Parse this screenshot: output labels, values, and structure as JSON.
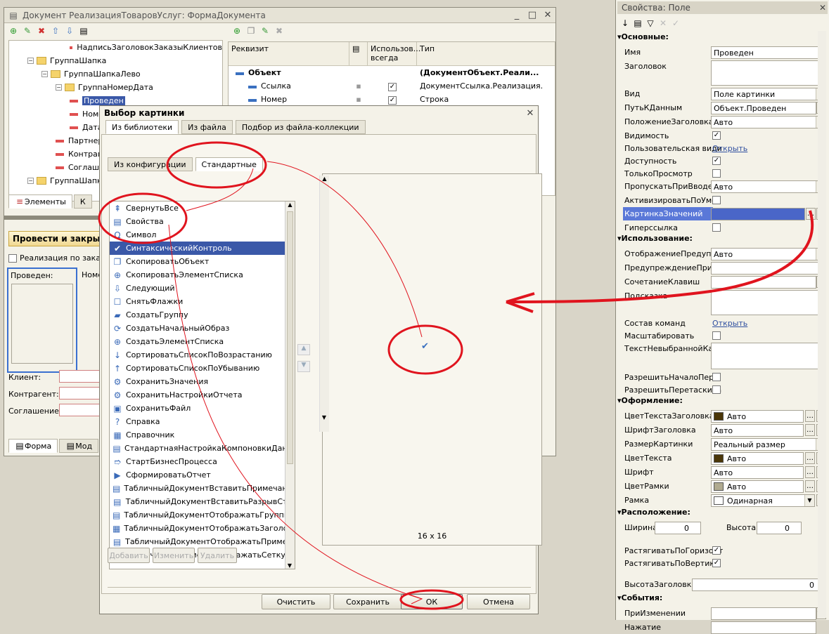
{
  "main": {
    "title": "Документ РеализацияТоваровУслуг: ФормаДокумента",
    "tree": [
      {
        "label": "НадписьЗаголовокЗаказыКлиентов",
        "indent": 4,
        "kind": "item"
      },
      {
        "label": "ГруппаШапка",
        "indent": 1,
        "kind": "group"
      },
      {
        "label": "ГруппаШапкаЛево",
        "indent": 2,
        "kind": "group"
      },
      {
        "label": "ГруппаНомерДата",
        "indent": 3,
        "kind": "group"
      },
      {
        "label": "Проведен",
        "indent": 4,
        "kind": "sel"
      },
      {
        "label": "Номер",
        "indent": 4,
        "kind": "item"
      },
      {
        "label": "Дата",
        "indent": 4,
        "kind": "item"
      },
      {
        "label": "Партнер",
        "indent": 3,
        "kind": "item"
      },
      {
        "label": "Контрагент",
        "indent": 3,
        "kind": "item"
      },
      {
        "label": "Соглашение",
        "indent": 3,
        "kind": "item"
      },
      {
        "label": "ГруппаШапка",
        "indent": 1,
        "kind": "group"
      }
    ],
    "tab_elements": "Элементы",
    "tab_k": "К",
    "grid_cols": {
      "rekvizit": "Реквизит",
      "use": "Использов... всегда",
      "type": "Тип"
    },
    "grid_rows": [
      {
        "name": "Объект",
        "type": "(ДокументОбъект.Реали...",
        "bold": true
      },
      {
        "name": "Ссылка",
        "type": "ДокументСсылка.Реализация..."
      },
      {
        "name": "Номер",
        "type": "Строка"
      }
    ],
    "form_btn": "Провести и закрыть",
    "form_check": "Реализация по заказу",
    "form_posted": "Проведен:",
    "form_nomer": "Номе",
    "form_client": "Клиент:",
    "form_contr": "Контрагент:",
    "form_sogl": "Соглашение:",
    "tab_forma": "Форма",
    "tab_mod": "Мод"
  },
  "dialog": {
    "title": "Выбор картинки",
    "tabs": [
      "Из библиотеки",
      "Из файла",
      "Подбор из файла-коллекции"
    ],
    "subtabs": [
      "Из конфигурации",
      "Стандартные"
    ],
    "items": [
      {
        "label": "СвернутьВсе",
        "icon": "⇞"
      },
      {
        "label": "Свойства",
        "icon": "▤"
      },
      {
        "label": "Символ",
        "icon": "Ω"
      },
      {
        "label": "СинтаксическийКонтроль",
        "icon": "✔",
        "sel": true
      },
      {
        "label": "СкопироватьОбъект",
        "icon": "❐"
      },
      {
        "label": "СкопироватьЭлементСписка",
        "icon": "⊕"
      },
      {
        "label": "Следующий",
        "icon": "⇩"
      },
      {
        "label": "СнятьФлажки",
        "icon": "☐"
      },
      {
        "label": "СоздатьГруппу",
        "icon": "▰"
      },
      {
        "label": "СоздатьНачальныйОбраз",
        "icon": "⟳"
      },
      {
        "label": "СоздатьЭлементСписка",
        "icon": "⊕"
      },
      {
        "label": "СортироватьСписокПоВозрастанию",
        "icon": "↓"
      },
      {
        "label": "СортироватьСписокПоУбыванию",
        "icon": "↑"
      },
      {
        "label": "СохранитьЗначения",
        "icon": "⚙"
      },
      {
        "label": "СохранитьНастройкиОтчета",
        "icon": "⚙"
      },
      {
        "label": "СохранитьФайл",
        "icon": "▣"
      },
      {
        "label": "Справка",
        "icon": "?"
      },
      {
        "label": "Справочник",
        "icon": "▦"
      },
      {
        "label": "СтандартнаяНастройкаКомпоновкиДан...",
        "icon": "▤"
      },
      {
        "label": "СтартБизнесПроцесса",
        "icon": "➱"
      },
      {
        "label": "СформироватьОтчет",
        "icon": "▶"
      },
      {
        "label": "ТабличныйДокументВставитьПримечан...",
        "icon": "▤"
      },
      {
        "label": "ТабличныйДокументВставитьРазрывСт...",
        "icon": "▤"
      },
      {
        "label": "ТабличныйДокументОтображатьГруппи...",
        "icon": "▤"
      },
      {
        "label": "ТабличныйДокументОтображатьЗаголо...",
        "icon": "▦"
      },
      {
        "label": "ТабличныйДокументОтображатьПриме...",
        "icon": "▤"
      },
      {
        "label": "ТабличныйДокументОтображатьСетку",
        "icon": "▦"
      }
    ],
    "size": "16 x 16",
    "add": "Добавить",
    "change": "Изменить",
    "delete": "Удалить",
    "clear": "Очистить",
    "save": "Сохранить",
    "ok": "ОК",
    "cancel": "Отмена"
  },
  "props": {
    "title": "Свойства: Поле",
    "s_main": "Основные:",
    "s_use": "Использование:",
    "s_design": "Оформление:",
    "s_layout": "Расположение:",
    "s_events": "События:",
    "name_l": "Имя",
    "name_v": "Проведен",
    "zag_l": "Заголовок",
    "vid_l": "Вид",
    "vid_v": "Поле картинки",
    "path_l": "ПутьКДанным",
    "path_v": "Объект.Проведен",
    "pos_l": "ПоложениеЗаголовка",
    "pos_v": "Авто",
    "vis_l": "Видимость",
    "userv_l": "Пользовательская види",
    "open": "Открыть",
    "dost_l": "Доступность",
    "ro_l": "ТолькоПросмотр",
    "skip_l": "ПропускатьПриВводе",
    "skip_v": "Авто",
    "act_l": "АктивизироватьПоУмо",
    "pic_l": "КартинкаЗначений",
    "hyper_l": "Гиперссылка",
    "warn_l": "ОтображениеПредупре",
    "warn_v": "Авто",
    "warn2_l": "ПредупреждениеПриРе",
    "keys_l": "СочетаниеКлавиш",
    "hint_l": "Подсказка",
    "cmd_l": "Состав команд",
    "scale_l": "Масштабировать",
    "notsel_l": "ТекстНевыбраннойКарт",
    "allowstart_l": "РазрешитьНачалоПере",
    "allowdrag_l": "РазрешитьПеретаскива",
    "tcol_l": "ЦветТекстаЗаголовка",
    "avto": "Авто",
    "font_l": "ШрифтЗаголовка",
    "picsize_l": "РазмерКартинки",
    "picsize_v": "Реальный размер",
    "tc_l": "ЦветТекста",
    "f_l": "Шрифт",
    "fc_l": "ЦветРамки",
    "frame_l": "Рамка",
    "frame_v": "Одинарная",
    "w_l": "Ширина",
    "w_v": "0",
    "h_l": "Высота",
    "h_v": "0",
    "sh_l": "РастягиватьПоГоризонт",
    "sv_l": "РастягиватьПоВертика",
    "zh_l": "ВысотаЗаголовка",
    "zh_v": "0",
    "onchange_l": "ПриИзменении",
    "press_l": "Нажатие"
  },
  "colors": {
    "annotation": "#e0141e",
    "selection": "#3a58a8",
    "picfield": "#4a66c8",
    "swatch_dark": "#4a3608",
    "swatch_frame": "#b0aa90"
  }
}
